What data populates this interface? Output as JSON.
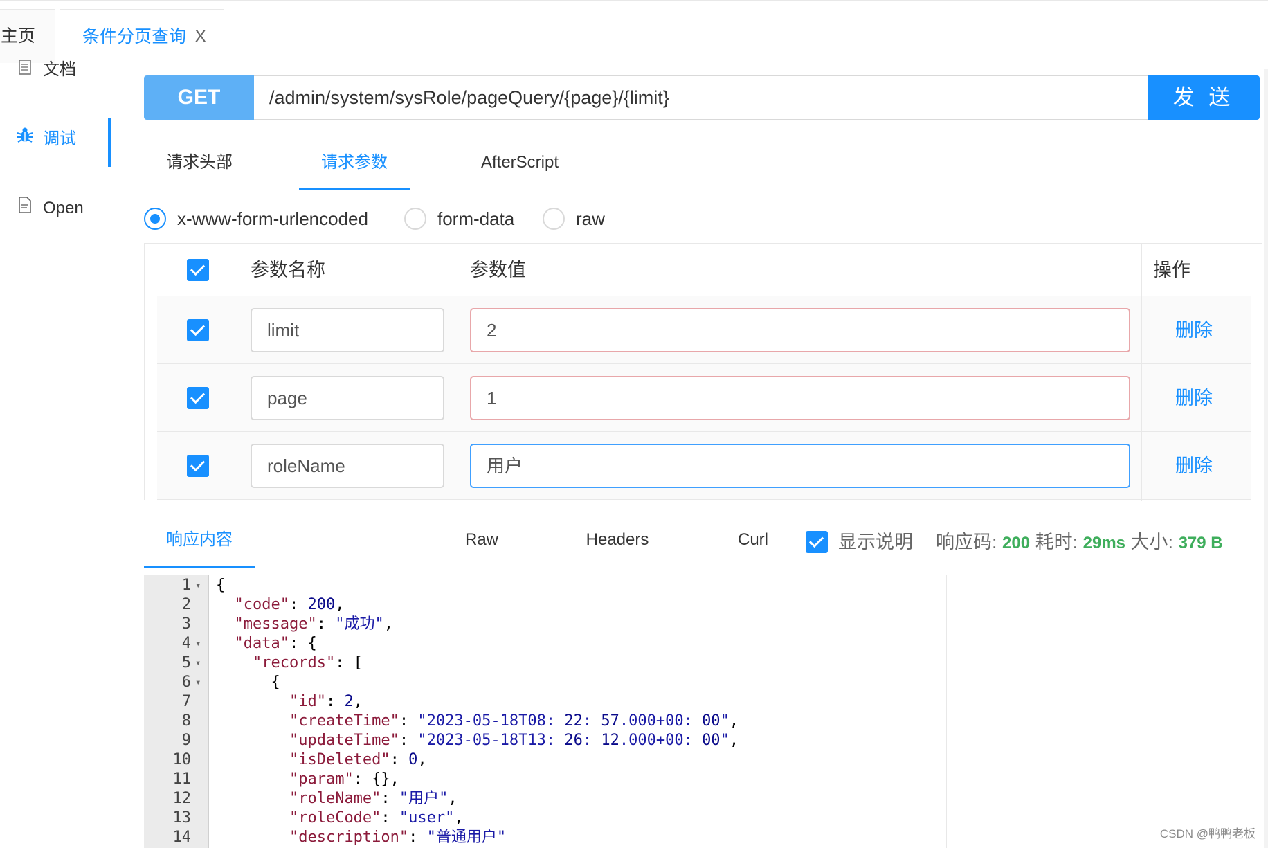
{
  "tabs": {
    "home": "主页",
    "active": "条件分页查询",
    "close": "X"
  },
  "sidebar": {
    "items": [
      {
        "icon": "document-icon",
        "label": "文档"
      },
      {
        "icon": "bug-icon",
        "label": "调试"
      },
      {
        "icon": "file-icon",
        "label": "Open"
      }
    ]
  },
  "request": {
    "method": "GET",
    "url": "/admin/system/sysRole/pageQuery/{page}/{limit}",
    "send_label": "发 送"
  },
  "req_tabs": [
    "请求头部",
    "请求参数",
    "AfterScript"
  ],
  "body_types": [
    "x-www-form-urlencoded",
    "form-data",
    "raw"
  ],
  "params": {
    "headers": {
      "name": "参数名称",
      "value": "参数值",
      "action": "操作"
    },
    "rows": [
      {
        "name": "limit",
        "value": "2",
        "action": "删除"
      },
      {
        "name": "page",
        "value": "1",
        "action": "删除"
      },
      {
        "name": "roleName",
        "value": "用户",
        "action": "删除"
      }
    ]
  },
  "resp_tabs": [
    "响应内容",
    "Raw",
    "Headers",
    "Curl"
  ],
  "status": {
    "show_desc": "显示说明",
    "code_label": "响应码:",
    "code": "200",
    "time_label": "耗时:",
    "time": "29ms",
    "size_label": "大小:",
    "size": "379 B"
  },
  "code_lines": [
    "{",
    "  \"code\": 200,",
    "  \"message\": \"成功\",",
    "  \"data\": {",
    "    \"records\": [",
    "      {",
    "        \"id\": 2,",
    "        \"createTime\": \"2023-05-18T08:22:57.000+00:00\",",
    "        \"updateTime\": \"2023-05-18T13:26:12.000+00:00\",",
    "        \"isDeleted\": 0,",
    "        \"param\": {},",
    "        \"roleName\": \"用户\",",
    "        \"roleCode\": \"user\",",
    "        \"description\": \"普通用户\""
  ],
  "watermark": "CSDN @鸭鸭老板"
}
